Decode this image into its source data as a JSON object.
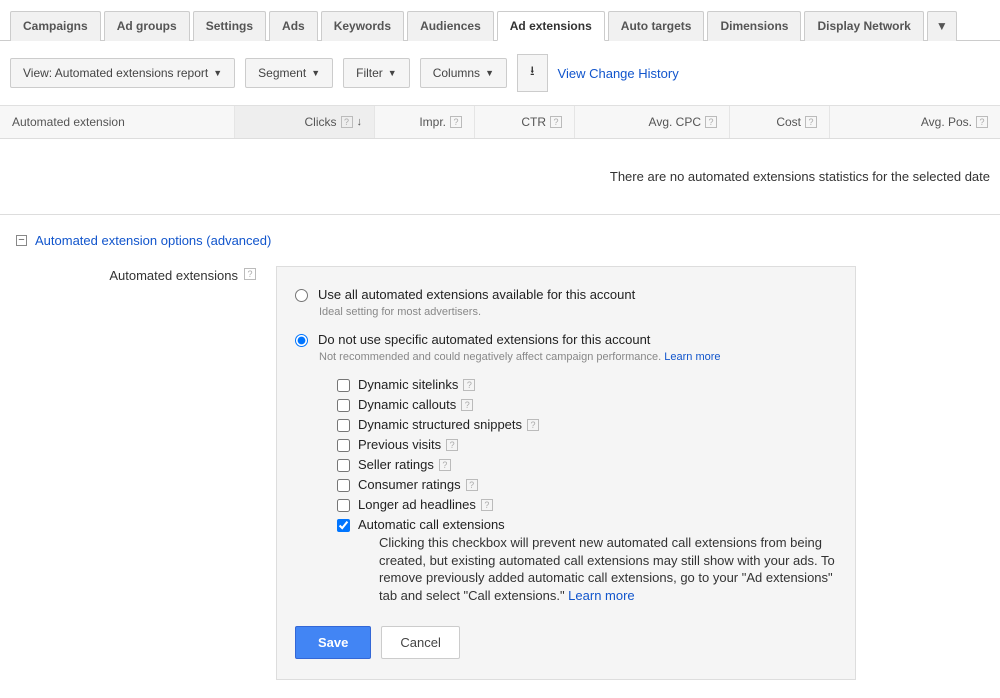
{
  "tabs": {
    "items": [
      {
        "label": "Campaigns",
        "active": false
      },
      {
        "label": "Ad groups",
        "active": false
      },
      {
        "label": "Settings",
        "active": false
      },
      {
        "label": "Ads",
        "active": false
      },
      {
        "label": "Keywords",
        "active": false
      },
      {
        "label": "Audiences",
        "active": false
      },
      {
        "label": "Ad extensions",
        "active": true
      },
      {
        "label": "Auto targets",
        "active": false
      },
      {
        "label": "Dimensions",
        "active": false
      },
      {
        "label": "Display Network",
        "active": false
      }
    ]
  },
  "toolbar": {
    "view": "View: Automated extensions report",
    "segment": "Segment",
    "filter": "Filter",
    "columns": "Columns",
    "history_link": "View Change History"
  },
  "table": {
    "headers": {
      "ext": "Automated extension",
      "clicks": "Clicks",
      "impr": "Impr.",
      "ctr": "CTR",
      "avgcpc": "Avg. CPC",
      "cost": "Cost",
      "avgpos": "Avg. Pos."
    },
    "empty": "There are no automated extensions statistics for the selected date"
  },
  "advanced": {
    "title": "Automated extension options (advanced)",
    "label": "Automated extensions",
    "opt1": {
      "label": "Use all automated extensions available for this account",
      "sub": "Ideal setting for most advertisers."
    },
    "opt2": {
      "label": "Do not use specific automated extensions for this account",
      "sub": "Not recommended and could negatively affect campaign performance.",
      "learn": "Learn more"
    },
    "checkboxes": [
      {
        "label": "Dynamic sitelinks",
        "help": true,
        "checked": false
      },
      {
        "label": "Dynamic callouts",
        "help": true,
        "checked": false
      },
      {
        "label": "Dynamic structured snippets",
        "help": true,
        "checked": false
      },
      {
        "label": "Previous visits",
        "help": true,
        "checked": false
      },
      {
        "label": "Seller ratings",
        "help": true,
        "checked": false
      },
      {
        "label": "Consumer ratings",
        "help": true,
        "checked": false
      },
      {
        "label": "Longer ad headlines",
        "help": true,
        "checked": false
      },
      {
        "label": "Automatic call extensions",
        "help": false,
        "checked": true,
        "desc": "Clicking this checkbox will prevent new automated call extensions from being created, but existing automated call extensions may still show with your ads. To remove previously added automatic call extensions, go to your \"Ad extensions\" tab and select \"Call extensions.\"",
        "learn": "Learn more"
      }
    ],
    "save": "Save",
    "cancel": "Cancel"
  }
}
